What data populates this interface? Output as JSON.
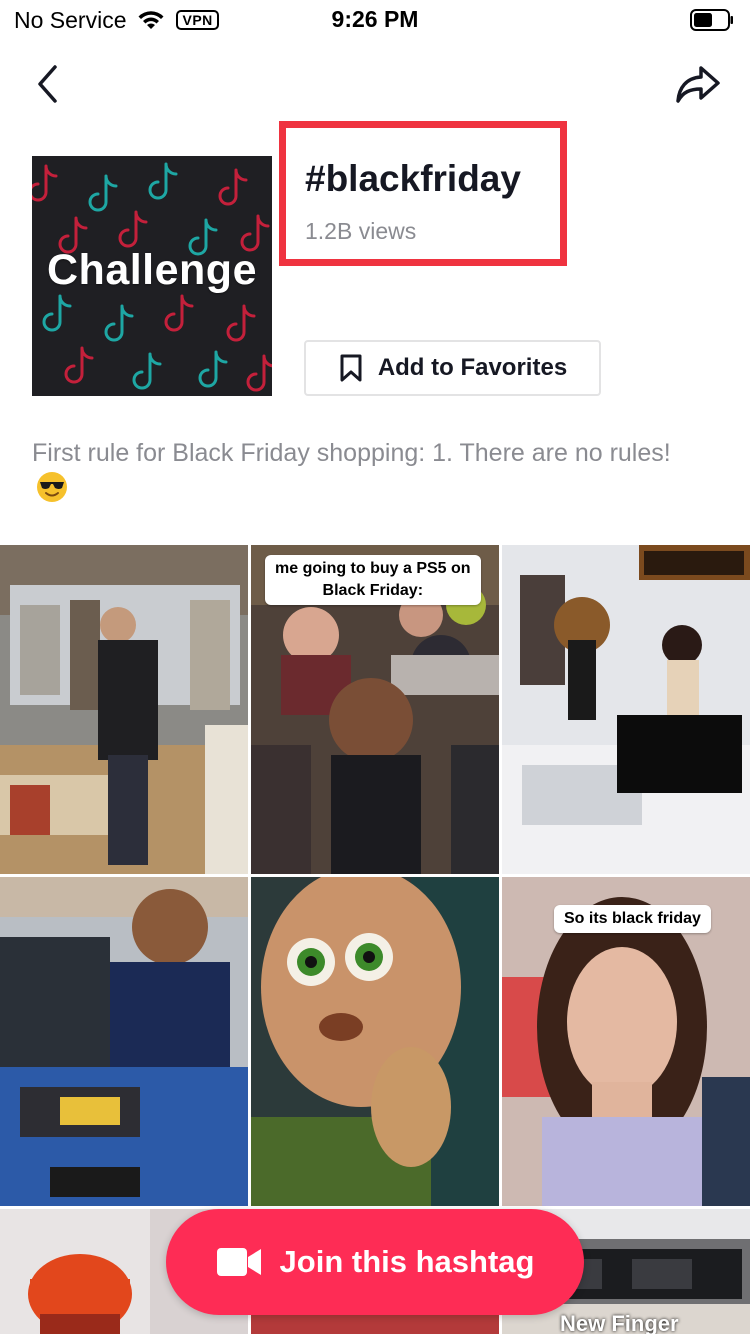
{
  "status_bar": {
    "carrier": "No Service",
    "vpn": "VPN",
    "time": "9:26 PM"
  },
  "header": {
    "challenge_label": "Challenge",
    "hashtag": "#blackfriday",
    "views": "1.2B views",
    "favorites_label": "Add to Favorites",
    "highlight_color": "#ef3340"
  },
  "description": {
    "text": "First rule for Black Friday shopping: 1. There are no rules!",
    "emoji": "smiling-face-with-sunglasses"
  },
  "videos": [
    {
      "caption": ""
    },
    {
      "caption_line1": "me going to buy a PS5 on",
      "caption_line2": "Black Friday:"
    },
    {
      "caption": ""
    },
    {
      "caption": ""
    },
    {
      "caption": ""
    },
    {
      "caption": "So its black friday"
    },
    {
      "caption": ""
    },
    {
      "caption": ""
    },
    {
      "caption": "New Finger"
    }
  ],
  "join_button": {
    "label": "Join this hashtag",
    "color": "#fe2c55"
  }
}
